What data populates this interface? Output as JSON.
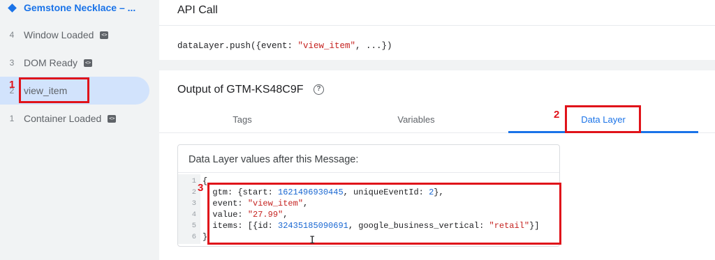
{
  "sidebar": {
    "title": "Gemstone Necklace – ...",
    "items": [
      {
        "num": "4",
        "label": "Window Loaded",
        "badge": "<>"
      },
      {
        "num": "3",
        "label": "DOM Ready",
        "badge": "<>"
      },
      {
        "num": "2",
        "label": "view_item",
        "badge": ""
      },
      {
        "num": "1",
        "label": "Container Loaded",
        "badge": "<>"
      }
    ]
  },
  "api_call": {
    "title": "API Call",
    "code_prefix": "dataLayer.push({event: ",
    "code_string": "\"view_item\"",
    "code_suffix": ", ...})"
  },
  "output": {
    "title": "Output of GTM-KS48C9F",
    "tabs": [
      {
        "label": "Tags"
      },
      {
        "label": "Variables"
      },
      {
        "label": "Data Layer"
      }
    ],
    "active_tab": "Data Layer",
    "panel_title": "Data Layer values after this Message:",
    "code_lines": [
      {
        "n": "1",
        "parts": [
          {
            "t": "{",
            "c": "plain"
          }
        ]
      },
      {
        "n": "2",
        "parts": [
          {
            "t": "  gtm: {start: ",
            "c": "plain"
          },
          {
            "t": "1621496930445",
            "c": "num"
          },
          {
            "t": ", uniqueEventId: ",
            "c": "plain"
          },
          {
            "t": "2",
            "c": "num"
          },
          {
            "t": "},",
            "c": "plain"
          }
        ]
      },
      {
        "n": "3",
        "parts": [
          {
            "t": "  event: ",
            "c": "plain"
          },
          {
            "t": "\"view_item\"",
            "c": "str"
          },
          {
            "t": ",",
            "c": "plain"
          }
        ]
      },
      {
        "n": "4",
        "parts": [
          {
            "t": "  value: ",
            "c": "plain"
          },
          {
            "t": "\"27.99\"",
            "c": "str"
          },
          {
            "t": ",",
            "c": "plain"
          }
        ]
      },
      {
        "n": "5",
        "parts": [
          {
            "t": "  items: [{id: ",
            "c": "plain"
          },
          {
            "t": "32435185090691",
            "c": "num"
          },
          {
            "t": ", google_business_vertical: ",
            "c": "plain"
          },
          {
            "t": "\"retail\"",
            "c": "str"
          },
          {
            "t": "}]",
            "c": "plain"
          }
        ]
      },
      {
        "n": "6",
        "parts": [
          {
            "t": "}",
            "c": "plain"
          }
        ]
      }
    ]
  },
  "annotations": [
    "1",
    "2",
    "3"
  ],
  "colors": {
    "accent": "#1a73e8",
    "annotation": "#e0131a",
    "selected_bg": "#d2e3fc"
  }
}
